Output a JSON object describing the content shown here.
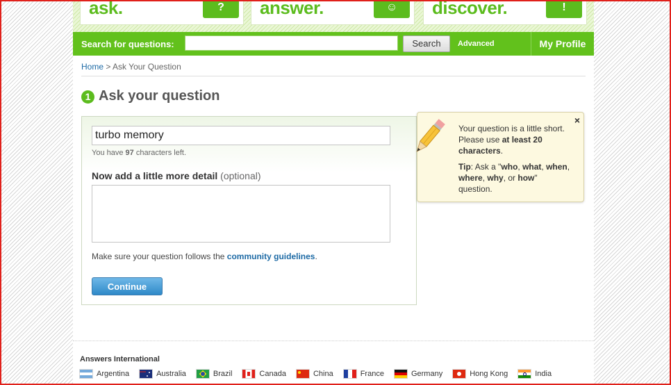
{
  "hero": {
    "tiles": [
      {
        "word": "ask.",
        "badge": "?"
      },
      {
        "word": "answer.",
        "badge": "☺"
      },
      {
        "word": "discover.",
        "badge": "!"
      }
    ]
  },
  "search": {
    "label": "Search for questions:",
    "value": "",
    "button": "Search",
    "advanced": "Advanced",
    "profile": "My Profile"
  },
  "breadcrumb": {
    "home": "Home",
    "separator": ">",
    "current": "Ask Your Question"
  },
  "step": {
    "number": "1",
    "title": "Ask your question"
  },
  "form": {
    "question_value": "turbo memory",
    "chars_prefix": "You have",
    "chars_count": "97",
    "chars_suffix": "characters left.",
    "detail_heading": "Now add a little more detail",
    "detail_optional": "(optional)",
    "guidelines_prefix": "Make sure your question follows the",
    "guidelines_link": "community guidelines",
    "guidelines_suffix": ".",
    "continue": "Continue"
  },
  "tip": {
    "close": "×",
    "msg_a": "Your question is a little short. Please use",
    "msg_b": "at least 20 characters",
    "msg_c": ".",
    "tip_label": "Tip",
    "tip_a": ": Ask a \"",
    "w1": "who",
    "w2": "what",
    "w3": "when",
    "w4": "where",
    "w5": "why",
    "w6": "how",
    "tip_end": "\" question."
  },
  "footer": {
    "heading": "Answers International",
    "countries": [
      "Argentina",
      "Australia",
      "Brazil",
      "Canada",
      "China",
      "France",
      "Germany",
      "Hong Kong",
      "India"
    ]
  },
  "colors": {
    "brand_green": "#62c11c",
    "link": "#1d6aa5",
    "frame_red": "#e0201a"
  }
}
